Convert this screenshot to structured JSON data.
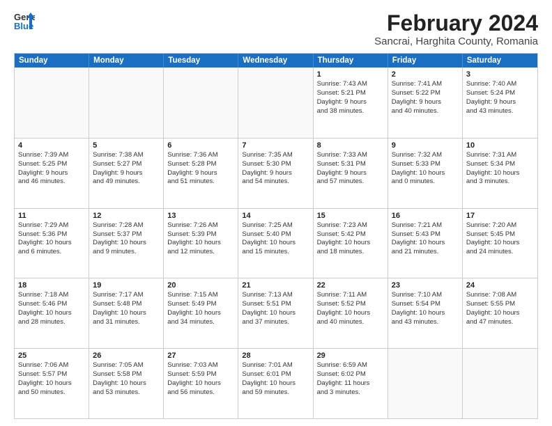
{
  "header": {
    "logo_line1": "General",
    "logo_line2": "Blue",
    "title": "February 2024",
    "subtitle": "Sancrai, Harghita County, Romania"
  },
  "days_of_week": [
    "Sunday",
    "Monday",
    "Tuesday",
    "Wednesday",
    "Thursday",
    "Friday",
    "Saturday"
  ],
  "weeks": [
    [
      {
        "day": "",
        "lines": []
      },
      {
        "day": "",
        "lines": []
      },
      {
        "day": "",
        "lines": []
      },
      {
        "day": "",
        "lines": []
      },
      {
        "day": "1",
        "lines": [
          "Sunrise: 7:43 AM",
          "Sunset: 5:21 PM",
          "Daylight: 9 hours",
          "and 38 minutes."
        ]
      },
      {
        "day": "2",
        "lines": [
          "Sunrise: 7:41 AM",
          "Sunset: 5:22 PM",
          "Daylight: 9 hours",
          "and 40 minutes."
        ]
      },
      {
        "day": "3",
        "lines": [
          "Sunrise: 7:40 AM",
          "Sunset: 5:24 PM",
          "Daylight: 9 hours",
          "and 43 minutes."
        ]
      }
    ],
    [
      {
        "day": "4",
        "lines": [
          "Sunrise: 7:39 AM",
          "Sunset: 5:25 PM",
          "Daylight: 9 hours",
          "and 46 minutes."
        ]
      },
      {
        "day": "5",
        "lines": [
          "Sunrise: 7:38 AM",
          "Sunset: 5:27 PM",
          "Daylight: 9 hours",
          "and 49 minutes."
        ]
      },
      {
        "day": "6",
        "lines": [
          "Sunrise: 7:36 AM",
          "Sunset: 5:28 PM",
          "Daylight: 9 hours",
          "and 51 minutes."
        ]
      },
      {
        "day": "7",
        "lines": [
          "Sunrise: 7:35 AM",
          "Sunset: 5:30 PM",
          "Daylight: 9 hours",
          "and 54 minutes."
        ]
      },
      {
        "day": "8",
        "lines": [
          "Sunrise: 7:33 AM",
          "Sunset: 5:31 PM",
          "Daylight: 9 hours",
          "and 57 minutes."
        ]
      },
      {
        "day": "9",
        "lines": [
          "Sunrise: 7:32 AM",
          "Sunset: 5:33 PM",
          "Daylight: 10 hours",
          "and 0 minutes."
        ]
      },
      {
        "day": "10",
        "lines": [
          "Sunrise: 7:31 AM",
          "Sunset: 5:34 PM",
          "Daylight: 10 hours",
          "and 3 minutes."
        ]
      }
    ],
    [
      {
        "day": "11",
        "lines": [
          "Sunrise: 7:29 AM",
          "Sunset: 5:36 PM",
          "Daylight: 10 hours",
          "and 6 minutes."
        ]
      },
      {
        "day": "12",
        "lines": [
          "Sunrise: 7:28 AM",
          "Sunset: 5:37 PM",
          "Daylight: 10 hours",
          "and 9 minutes."
        ]
      },
      {
        "day": "13",
        "lines": [
          "Sunrise: 7:26 AM",
          "Sunset: 5:39 PM",
          "Daylight: 10 hours",
          "and 12 minutes."
        ]
      },
      {
        "day": "14",
        "lines": [
          "Sunrise: 7:25 AM",
          "Sunset: 5:40 PM",
          "Daylight: 10 hours",
          "and 15 minutes."
        ]
      },
      {
        "day": "15",
        "lines": [
          "Sunrise: 7:23 AM",
          "Sunset: 5:42 PM",
          "Daylight: 10 hours",
          "and 18 minutes."
        ]
      },
      {
        "day": "16",
        "lines": [
          "Sunrise: 7:21 AM",
          "Sunset: 5:43 PM",
          "Daylight: 10 hours",
          "and 21 minutes."
        ]
      },
      {
        "day": "17",
        "lines": [
          "Sunrise: 7:20 AM",
          "Sunset: 5:45 PM",
          "Daylight: 10 hours",
          "and 24 minutes."
        ]
      }
    ],
    [
      {
        "day": "18",
        "lines": [
          "Sunrise: 7:18 AM",
          "Sunset: 5:46 PM",
          "Daylight: 10 hours",
          "and 28 minutes."
        ]
      },
      {
        "day": "19",
        "lines": [
          "Sunrise: 7:17 AM",
          "Sunset: 5:48 PM",
          "Daylight: 10 hours",
          "and 31 minutes."
        ]
      },
      {
        "day": "20",
        "lines": [
          "Sunrise: 7:15 AM",
          "Sunset: 5:49 PM",
          "Daylight: 10 hours",
          "and 34 minutes."
        ]
      },
      {
        "day": "21",
        "lines": [
          "Sunrise: 7:13 AM",
          "Sunset: 5:51 PM",
          "Daylight: 10 hours",
          "and 37 minutes."
        ]
      },
      {
        "day": "22",
        "lines": [
          "Sunrise: 7:11 AM",
          "Sunset: 5:52 PM",
          "Daylight: 10 hours",
          "and 40 minutes."
        ]
      },
      {
        "day": "23",
        "lines": [
          "Sunrise: 7:10 AM",
          "Sunset: 5:54 PM",
          "Daylight: 10 hours",
          "and 43 minutes."
        ]
      },
      {
        "day": "24",
        "lines": [
          "Sunrise: 7:08 AM",
          "Sunset: 5:55 PM",
          "Daylight: 10 hours",
          "and 47 minutes."
        ]
      }
    ],
    [
      {
        "day": "25",
        "lines": [
          "Sunrise: 7:06 AM",
          "Sunset: 5:57 PM",
          "Daylight: 10 hours",
          "and 50 minutes."
        ]
      },
      {
        "day": "26",
        "lines": [
          "Sunrise: 7:05 AM",
          "Sunset: 5:58 PM",
          "Daylight: 10 hours",
          "and 53 minutes."
        ]
      },
      {
        "day": "27",
        "lines": [
          "Sunrise: 7:03 AM",
          "Sunset: 5:59 PM",
          "Daylight: 10 hours",
          "and 56 minutes."
        ]
      },
      {
        "day": "28",
        "lines": [
          "Sunrise: 7:01 AM",
          "Sunset: 6:01 PM",
          "Daylight: 10 hours",
          "and 59 minutes."
        ]
      },
      {
        "day": "29",
        "lines": [
          "Sunrise: 6:59 AM",
          "Sunset: 6:02 PM",
          "Daylight: 11 hours",
          "and 3 minutes."
        ]
      },
      {
        "day": "",
        "lines": []
      },
      {
        "day": "",
        "lines": []
      }
    ]
  ]
}
